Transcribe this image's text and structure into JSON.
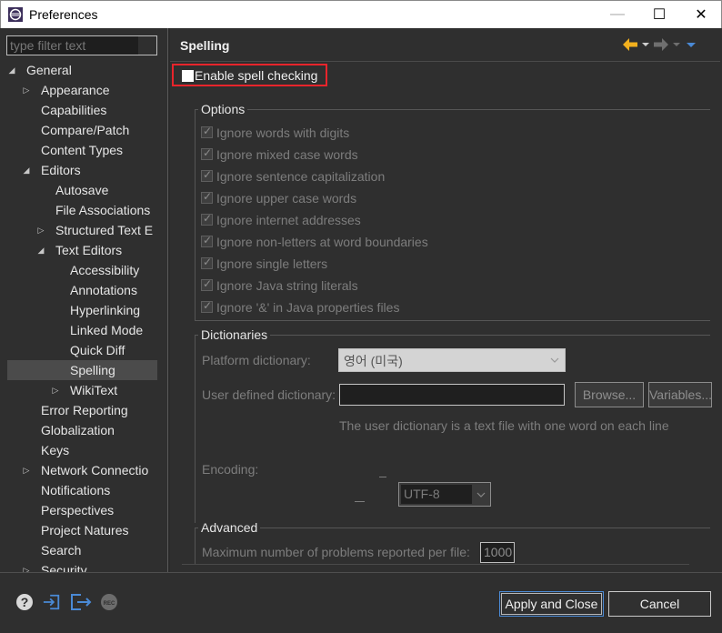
{
  "window": {
    "title": "Preferences",
    "minimize": "—",
    "maximize": "☐",
    "close": "✕"
  },
  "filter": {
    "placeholder": "type filter text"
  },
  "tree": [
    {
      "label": "General",
      "level": 0,
      "expander": "expanded"
    },
    {
      "label": "Appearance",
      "level": 1,
      "expander": "collapsed"
    },
    {
      "label": "Capabilities",
      "level": 1,
      "expander": "none"
    },
    {
      "label": "Compare/Patch",
      "level": 1,
      "expander": "none"
    },
    {
      "label": "Content Types",
      "level": 1,
      "expander": "none"
    },
    {
      "label": "Editors",
      "level": 1,
      "expander": "expanded"
    },
    {
      "label": "Autosave",
      "level": 2,
      "expander": "none"
    },
    {
      "label": "File Associations",
      "level": 2,
      "expander": "none"
    },
    {
      "label": "Structured Text E",
      "level": 2,
      "expander": "collapsed"
    },
    {
      "label": "Text Editors",
      "level": 2,
      "expander": "expanded"
    },
    {
      "label": "Accessibility",
      "level": 3,
      "expander": "none"
    },
    {
      "label": "Annotations",
      "level": 3,
      "expander": "none"
    },
    {
      "label": "Hyperlinking",
      "level": 3,
      "expander": "none"
    },
    {
      "label": "Linked Mode",
      "level": 3,
      "expander": "none"
    },
    {
      "label": "Quick Diff",
      "level": 3,
      "expander": "none"
    },
    {
      "label": "Spelling",
      "level": 3,
      "expander": "none",
      "selected": true
    },
    {
      "label": "WikiText",
      "level": 3,
      "expander": "collapsed"
    },
    {
      "label": "Error Reporting",
      "level": 1,
      "expander": "none"
    },
    {
      "label": "Globalization",
      "level": 1,
      "expander": "none"
    },
    {
      "label": "Keys",
      "level": 1,
      "expander": "none"
    },
    {
      "label": "Network Connectio",
      "level": 1,
      "expander": "collapsed"
    },
    {
      "label": "Notifications",
      "level": 1,
      "expander": "none"
    },
    {
      "label": "Perspectives",
      "level": 1,
      "expander": "none"
    },
    {
      "label": "Project Natures",
      "level": 1,
      "expander": "none"
    },
    {
      "label": "Search",
      "level": 1,
      "expander": "none"
    },
    {
      "label": "Security",
      "level": 1,
      "expander": "collapsed"
    }
  ],
  "page": {
    "title": "Spelling",
    "enable_label": "Enable spell checking",
    "enable_checked": false
  },
  "options": {
    "title": "Options",
    "items": [
      "Ignore words with digits",
      "Ignore mixed case words",
      "Ignore sentence capitalization",
      "Ignore upper case words",
      "Ignore internet addresses",
      "Ignore non-letters at word boundaries",
      "Ignore single letters",
      "Ignore Java string literals",
      "Ignore '&' in Java properties files"
    ]
  },
  "dictionaries": {
    "title": "Dictionaries",
    "platform_label": "Platform dictionary:",
    "platform_value": "영어 (미국)",
    "user_label": "User defined dictionary:",
    "user_value": "",
    "browse": "Browse...",
    "variables": "Variables...",
    "hint": "The user dictionary is a text file with one word on each line",
    "encoding_label": "Encoding:",
    "encoding_value": "UTF-8"
  },
  "advanced": {
    "title": "Advanced",
    "max_label": "Maximum number of problems reported per file:",
    "max_value": "1000"
  },
  "buttons": {
    "apply_close": "Apply and Close",
    "cancel": "Cancel"
  },
  "icons": [
    "help-icon",
    "import-icon",
    "export-icon",
    "record-icon"
  ],
  "colors": {
    "bg": "#2f2f2f",
    "highlight": "#e8242b",
    "arrow_back": "#f2b01e",
    "arrow_menu": "#4a8ad6"
  }
}
